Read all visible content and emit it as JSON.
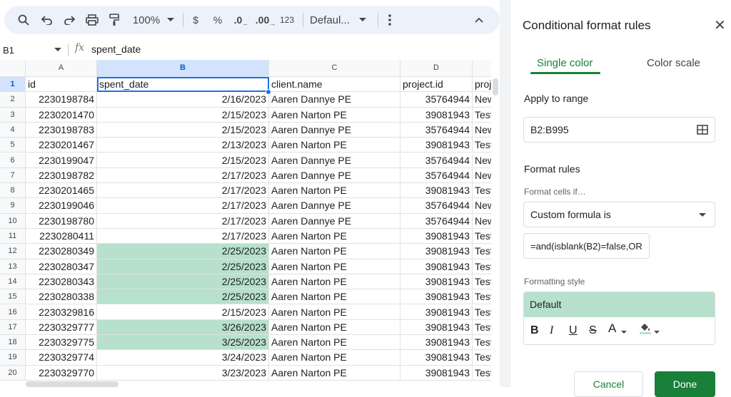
{
  "toolbar": {
    "zoom": "100%",
    "currency": "$",
    "percent": "%",
    "decrease_decimal": ".0",
    "increase_decimal": ".00",
    "number_format": "123",
    "font": "Defaul...",
    "icons": [
      "search-icon",
      "undo-icon",
      "redo-icon",
      "print-icon",
      "paint-format-icon",
      "more-vert-icon",
      "collapse-icon"
    ]
  },
  "formula_bar": {
    "cell_ref": "B1",
    "fx": "fx",
    "content": "spent_date"
  },
  "grid": {
    "columns": [
      "A",
      "B",
      "C",
      "D",
      ""
    ],
    "headers": [
      "id",
      "spent_date",
      "client.name",
      "project.id",
      "proj"
    ],
    "rows": [
      {
        "n": "2",
        "id": "2230198784",
        "date": "2/16/2023",
        "client": "Aaren Dannye PE",
        "pid": "35764944",
        "proj": "New",
        "hl": false
      },
      {
        "n": "3",
        "id": "2230201470",
        "date": "2/15/2023",
        "client": "Aaren Narton PE",
        "pid": "39081943",
        "proj": "Test",
        "hl": false
      },
      {
        "n": "4",
        "id": "2230198783",
        "date": "2/15/2023",
        "client": "Aaren Dannye PE",
        "pid": "35764944",
        "proj": "New",
        "hl": false
      },
      {
        "n": "5",
        "id": "2230201467",
        "date": "2/13/2023",
        "client": "Aaren Narton PE",
        "pid": "39081943",
        "proj": "Test",
        "hl": false
      },
      {
        "n": "6",
        "id": "2230199047",
        "date": "2/15/2023",
        "client": "Aaren Dannye PE",
        "pid": "35764944",
        "proj": "New",
        "hl": false
      },
      {
        "n": "7",
        "id": "2230198782",
        "date": "2/17/2023",
        "client": "Aaren Dannye PE",
        "pid": "35764944",
        "proj": "New",
        "hl": false
      },
      {
        "n": "8",
        "id": "2230201465",
        "date": "2/17/2023",
        "client": "Aaren Narton PE",
        "pid": "39081943",
        "proj": "Test",
        "hl": false
      },
      {
        "n": "9",
        "id": "2230199046",
        "date": "2/17/2023",
        "client": "Aaren Dannye PE",
        "pid": "35764944",
        "proj": "New",
        "hl": false
      },
      {
        "n": "10",
        "id": "2230198780",
        "date": "2/17/2023",
        "client": "Aaren Dannye PE",
        "pid": "35764944",
        "proj": "New",
        "hl": false
      },
      {
        "n": "11",
        "id": "2230280411",
        "date": "2/17/2023",
        "client": "Aaren Narton PE",
        "pid": "39081943",
        "proj": "Test",
        "hl": false
      },
      {
        "n": "12",
        "id": "2230280349",
        "date": "2/25/2023",
        "client": "Aaren Narton PE",
        "pid": "39081943",
        "proj": "Test",
        "hl": true
      },
      {
        "n": "13",
        "id": "2230280347",
        "date": "2/25/2023",
        "client": "Aaren Narton PE",
        "pid": "39081943",
        "proj": "Test",
        "hl": true
      },
      {
        "n": "14",
        "id": "2230280343",
        "date": "2/25/2023",
        "client": "Aaren Narton PE",
        "pid": "39081943",
        "proj": "Test",
        "hl": true
      },
      {
        "n": "15",
        "id": "2230280338",
        "date": "2/25/2023",
        "client": "Aaren Narton PE",
        "pid": "39081943",
        "proj": "Test",
        "hl": true
      },
      {
        "n": "16",
        "id": "2230329816",
        "date": "2/15/2023",
        "client": "Aaren Narton PE",
        "pid": "39081943",
        "proj": "Test",
        "hl": false
      },
      {
        "n": "17",
        "id": "2230329777",
        "date": "3/26/2023",
        "client": "Aaren Narton PE",
        "pid": "39081943",
        "proj": "Test",
        "hl": true
      },
      {
        "n": "18",
        "id": "2230329775",
        "date": "3/25/2023",
        "client": "Aaren Narton PE",
        "pid": "39081943",
        "proj": "Test",
        "hl": true
      },
      {
        "n": "19",
        "id": "2230329774",
        "date": "3/24/2023",
        "client": "Aaren Narton PE",
        "pid": "39081943",
        "proj": "Test",
        "hl": false
      },
      {
        "n": "20",
        "id": "2230329770",
        "date": "3/23/2023",
        "client": "Aaren Narton PE",
        "pid": "39081943",
        "proj": "Test",
        "hl": false
      }
    ]
  },
  "panel": {
    "title": "Conditional format rules",
    "close": "✕",
    "tabs": [
      "Single color",
      "Color scale"
    ],
    "apply_to_range_label": "Apply to range",
    "range": "B2:B995",
    "format_rules_label": "Format rules",
    "format_cells_if_label": "Format cells if…",
    "condition": "Custom formula is",
    "formula": "=and(isblank(B2)=false,OR",
    "formatting_style_label": "Formatting style",
    "style_preview": "Default",
    "style_buttons": [
      "B",
      "I",
      "U",
      "S",
      "A"
    ],
    "cancel": "Cancel",
    "done": "Done"
  },
  "colors": {
    "highlight": "#b7e1cd",
    "accent": "#188038",
    "toolbar_bg": "#edf2fa",
    "selected_header": "#d3e3fd"
  }
}
